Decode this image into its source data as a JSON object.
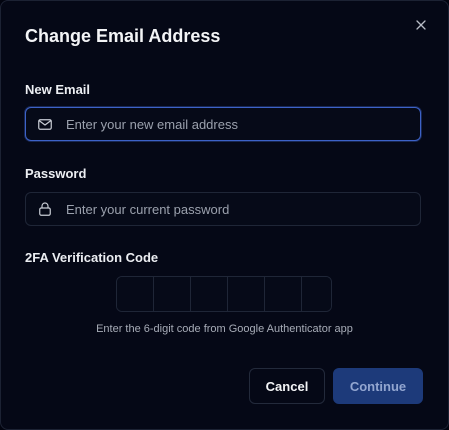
{
  "dialog": {
    "title": "Change Email Address",
    "close_icon": "close-icon"
  },
  "new_email": {
    "label": "New Email",
    "placeholder": "Enter your new email address",
    "value": "",
    "icon": "mail-icon"
  },
  "password": {
    "label": "Password",
    "placeholder": "Enter your current password",
    "value": "",
    "icon": "lock-icon"
  },
  "twofa": {
    "label": "2FA Verification Code",
    "digits": [
      "",
      "",
      "",
      "",
      "",
      ""
    ],
    "hint": "Enter the 6-digit code from Google Authenticator app"
  },
  "actions": {
    "cancel_label": "Cancel",
    "continue_label": "Continue"
  },
  "colors": {
    "background": "#050816",
    "focus_border": "#3d62c7",
    "primary_button": "#1d3a7a"
  }
}
